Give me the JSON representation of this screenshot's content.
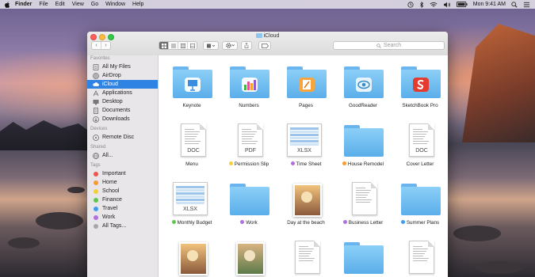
{
  "menubar": {
    "app_name": "Finder",
    "items": [
      "File",
      "Edit",
      "View",
      "Go",
      "Window",
      "Help"
    ],
    "clock": "Mon 9:41 AM"
  },
  "window": {
    "title": "iCloud",
    "search_placeholder": "Search"
  },
  "sidebar": {
    "favorites_heading": "Favorites",
    "favorites": [
      {
        "label": "All My Files",
        "icon": "all-files-icon"
      },
      {
        "label": "AirDrop",
        "icon": "airdrop-icon"
      },
      {
        "label": "iCloud",
        "icon": "cloud-icon",
        "selected": true
      },
      {
        "label": "Applications",
        "icon": "applications-icon"
      },
      {
        "label": "Desktop",
        "icon": "desktop-icon"
      },
      {
        "label": "Documents",
        "icon": "documents-icon"
      },
      {
        "label": "Downloads",
        "icon": "downloads-icon"
      }
    ],
    "devices_heading": "Devices",
    "devices": [
      {
        "label": "Remote Disc",
        "icon": "disc-icon"
      }
    ],
    "shared_heading": "Shared",
    "shared": [
      {
        "label": "All...",
        "icon": "network-icon"
      }
    ],
    "tags_heading": "Tags",
    "tags": [
      {
        "label": "Important",
        "color": "#f0554d"
      },
      {
        "label": "Home",
        "color": "#f79a33"
      },
      {
        "label": "School",
        "color": "#f3cf3a"
      },
      {
        "label": "Finance",
        "color": "#5cc84a"
      },
      {
        "label": "Travel",
        "color": "#3c9cf0"
      },
      {
        "label": "Work",
        "color": "#b26ee0"
      },
      {
        "label": "All Tags...",
        "color": "#a6a6a6"
      }
    ]
  },
  "files": [
    {
      "name": "Keynote",
      "kind": "folder",
      "app": "keynote"
    },
    {
      "name": "Numbers",
      "kind": "folder",
      "app": "numbers"
    },
    {
      "name": "Pages",
      "kind": "folder",
      "app": "pages"
    },
    {
      "name": "GoodReader",
      "kind": "folder",
      "app": "goodreader"
    },
    {
      "name": "SketchBook Pro",
      "kind": "folder",
      "app": "sketchbook"
    },
    {
      "name": "Menu",
      "kind": "doc",
      "ext": "DOC"
    },
    {
      "name": "Permission Slip",
      "kind": "doc",
      "ext": "PDF",
      "tag_color": "#f3cf3a"
    },
    {
      "name": "Time Sheet",
      "kind": "sheet",
      "ext": "XLSX",
      "tag_color": "#b26ee0"
    },
    {
      "name": "House Remodel",
      "kind": "folder",
      "tag_color": "#f79a33"
    },
    {
      "name": "Cover Letter",
      "kind": "doc",
      "ext": "DOC"
    },
    {
      "name": "Monthly Budget",
      "kind": "sheet",
      "ext": "XLSX",
      "tag_color": "#5cc84a"
    },
    {
      "name": "Work",
      "kind": "folder",
      "tag_color": "#b26ee0"
    },
    {
      "name": "Day at the beach",
      "kind": "photo"
    },
    {
      "name": "Business Letter",
      "kind": "letter",
      "tag_color": "#b26ee0"
    },
    {
      "name": "Summer Plans",
      "kind": "folder",
      "tag_color": "#3c9cf0"
    },
    {
      "name": "",
      "kind": "photo"
    },
    {
      "name": "",
      "kind": "photo"
    },
    {
      "name": "",
      "kind": "doc"
    },
    {
      "name": "",
      "kind": "folder"
    },
    {
      "name": "",
      "kind": "doc"
    }
  ]
}
